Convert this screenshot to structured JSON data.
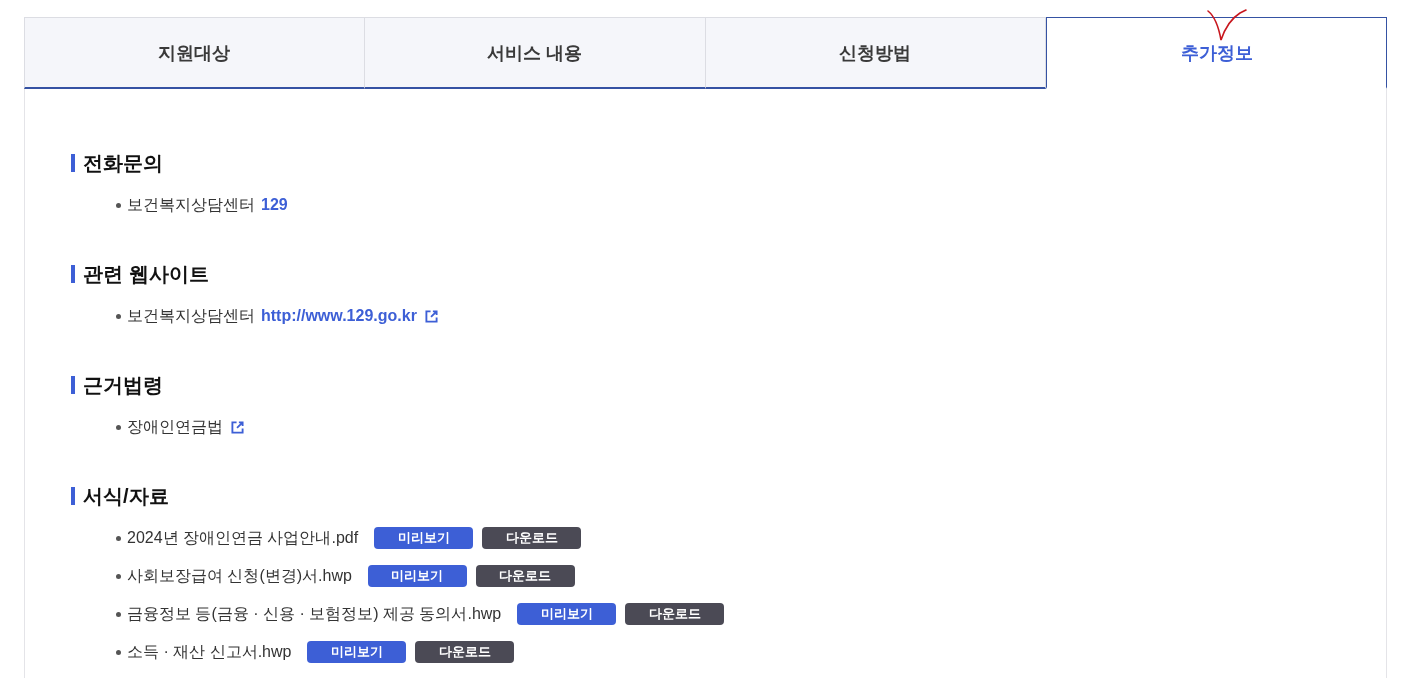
{
  "tabs": [
    {
      "label": "지원대상",
      "selected": false
    },
    {
      "label": "서비스 내용",
      "selected": false
    },
    {
      "label": "신청방법",
      "selected": false
    },
    {
      "label": "추가정보",
      "selected": true
    }
  ],
  "sections": [
    {
      "title": "전화문의",
      "items": [
        {
          "text": "보건복지상담센터",
          "link": "129",
          "external": false
        }
      ]
    },
    {
      "title": "관련 웹사이트",
      "items": [
        {
          "text": "보건복지상담센터",
          "link": "http://www.129.go.kr",
          "external": true
        }
      ]
    },
    {
      "title": "근거법령",
      "items": [
        {
          "text": "장애인연금법",
          "external": true
        }
      ]
    },
    {
      "title": "서식/자료",
      "items": [
        {
          "text": "2024년 장애인연금 사업안내.pdf",
          "external": false,
          "buttons": [
            {
              "label": "미리보기",
              "kind": "preview"
            },
            {
              "label": "다운로드",
              "kind": "download"
            }
          ]
        },
        {
          "text": "사회보장급여 신청(변경)서.hwp",
          "external": false,
          "buttons": [
            {
              "label": "미리보기",
              "kind": "preview"
            },
            {
              "label": "다운로드",
              "kind": "download"
            }
          ]
        },
        {
          "text": "금융정보 등(금융 · 신용 · 보험정보) 제공 동의서.hwp",
          "external": false,
          "buttons": [
            {
              "label": "미리보기",
              "kind": "preview"
            },
            {
              "label": "다운로드",
              "kind": "download"
            }
          ]
        },
        {
          "text": "소득 · 재산 신고서.hwp",
          "external": false,
          "buttons": [
            {
              "label": "미리보기",
              "kind": "preview"
            },
            {
              "label": "다운로드",
              "kind": "download"
            }
          ]
        }
      ]
    }
  ]
}
